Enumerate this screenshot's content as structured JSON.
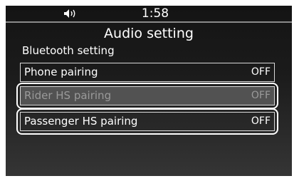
{
  "status": {
    "time": "1:58",
    "icon": "speaker-volume-icon"
  },
  "header": {
    "title": "Audio setting"
  },
  "section": {
    "label": "Bluetooth setting"
  },
  "items": [
    {
      "label": "Phone pairing",
      "value": "OFF",
      "state": "normal"
    },
    {
      "label": "Rider HS pairing",
      "value": "OFF",
      "state": "highlighted"
    },
    {
      "label": "Passenger HS pairing",
      "value": "OFF",
      "state": "outlined"
    }
  ],
  "colors": {
    "background_top": "#141414",
    "background_bottom": "#353535",
    "text": "#ffffff",
    "dimmed_text": "#9a9a9a",
    "highlight_fill": "#525252"
  }
}
